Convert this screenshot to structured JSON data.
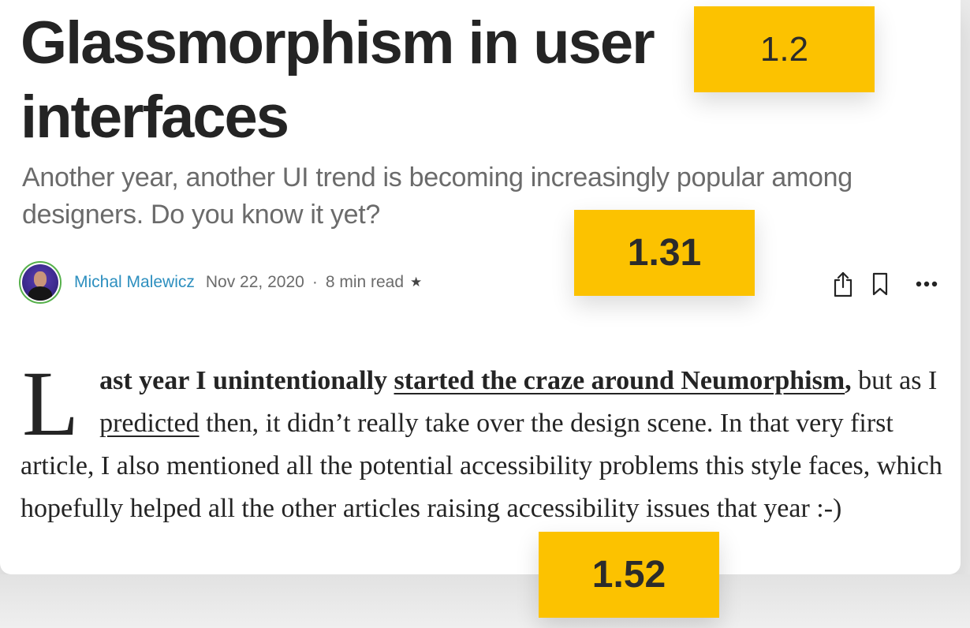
{
  "article": {
    "title": "Glassmorphism in user interfaces",
    "subtitle": "Another year, another UI trend is becoming increasingly popular among designers. Do you know it yet?",
    "author": "Michal Malewicz",
    "date": "Nov 22, 2020",
    "separator": "·",
    "read_time": "8 min read",
    "member_star": "★",
    "body": {
      "dropcap": "L",
      "lead": "ast year I unintentionally ",
      "link1": "started the craze around Neumorphism",
      "after_link1": ",",
      "part2": " but as I ",
      "link2": "predicted",
      "part3": " then, it didn’t really take over the design scene. In that very first article, I also mentioned all the potential accessibility problems this style faces, which hopefully helped all the other articles raising accessibility issues that year :-)"
    }
  },
  "actions": {
    "icons": [
      "share-icon",
      "bookmark-icon",
      "more-icon"
    ]
  },
  "annotations": [
    {
      "label": "1.2"
    },
    {
      "label": "1.31"
    },
    {
      "label": "1.52"
    }
  ],
  "colors": {
    "badge": "#fcc200",
    "author_link": "#2d8fbf",
    "avatar_ring": "#55b04a",
    "text": "#242424",
    "muted": "#6b6b6b"
  }
}
